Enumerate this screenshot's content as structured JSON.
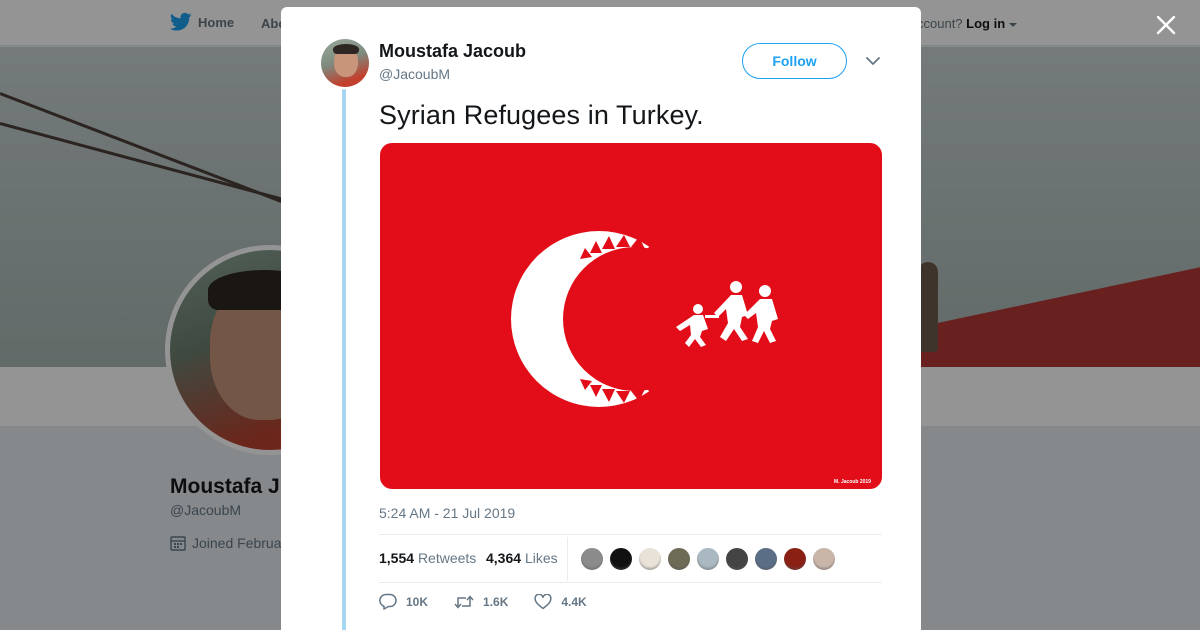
{
  "nav": {
    "home_label": "Home",
    "about_label": "Abo",
    "login_prefix": "ccount?",
    "login_label": "Log in"
  },
  "profile": {
    "name": "Moustafa J",
    "handle": "@JacoubM",
    "joined": "Joined Februa"
  },
  "tweet": {
    "author_name": "Moustafa Jacoub",
    "author_handle": "@JacoubM",
    "follow_label": "Follow",
    "text": "Syrian Refugees in Turkey.",
    "media_credit": "M. Jacoub 2019",
    "timestamp": "5:24 AM - 21 Jul 2019",
    "retweets_count": "1,554",
    "retweets_label": "Retweets",
    "likes_count": "4,364",
    "likes_label": "Likes",
    "actions": {
      "reply_count": "10K",
      "retweet_count": "1.6K",
      "like_count": "4.4K"
    },
    "liker_avatars": [
      "#8b8b8b",
      "#111111",
      "#e8e2d8",
      "#6d6a55",
      "#aab8c2",
      "#444444",
      "#5a6e86",
      "#8a1f14",
      "#c9b4a8"
    ]
  },
  "colors": {
    "accent": "#1da1f2",
    "flag_red": "#e20d18",
    "thread_line": "#a7d6f3"
  },
  "icons": [
    "twitter-bird-icon",
    "caret-down-icon",
    "close-icon",
    "calendar-icon",
    "reply-icon",
    "retweet-icon",
    "heart-icon"
  ]
}
